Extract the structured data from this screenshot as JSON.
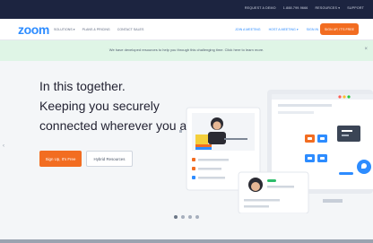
{
  "topbar": {
    "links": [
      "REQUEST A DEMO",
      "1.888.799.9666",
      "RESOURCES ▾",
      "SUPPORT"
    ]
  },
  "nav": {
    "logo": "zoom",
    "left_links": [
      "SOLUTIONS ▾",
      "PLANS & PRICING",
      "CONTACT SALES"
    ],
    "right_links": [
      "JOIN A MEETING",
      "HOST A MEETING ▾",
      "SIGN IN"
    ],
    "signup": "SIGN UP, IT'S FREE"
  },
  "banner": {
    "text": "We have developed resources to help you through this challenging time. Click here to learn more.",
    "close": "×"
  },
  "hero": {
    "line1": "In this together.",
    "line2": "Keeping you securely",
    "line3": "connected wherever you are.",
    "primary_button": "Sign Up, It's Free",
    "secondary_button": "Hybrid Resources",
    "slides": 4,
    "active_slide": 1
  },
  "colors": {
    "brand_blue": "#2d8cff",
    "cta_orange": "#f26d21",
    "topbar": "#1c2440",
    "banner_bg": "#dff5e6"
  }
}
